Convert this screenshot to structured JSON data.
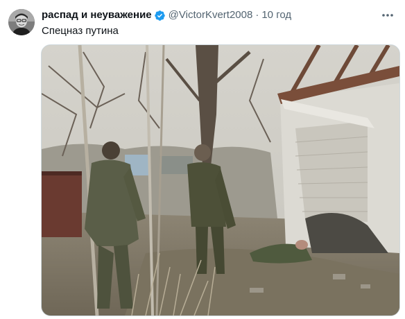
{
  "tweet": {
    "author": {
      "display_name": "распад и неуважение",
      "handle": "@VictorKvert2008",
      "verified": true,
      "avatar_icon": "user-avatar"
    },
    "separator": "·",
    "time": "10 год",
    "text": "Спецназ путина",
    "media": {
      "type": "photo"
    }
  },
  "colors": {
    "text_primary": "#0f1419",
    "text_secondary": "#536471",
    "verified_blue": "#1d9bf0"
  }
}
